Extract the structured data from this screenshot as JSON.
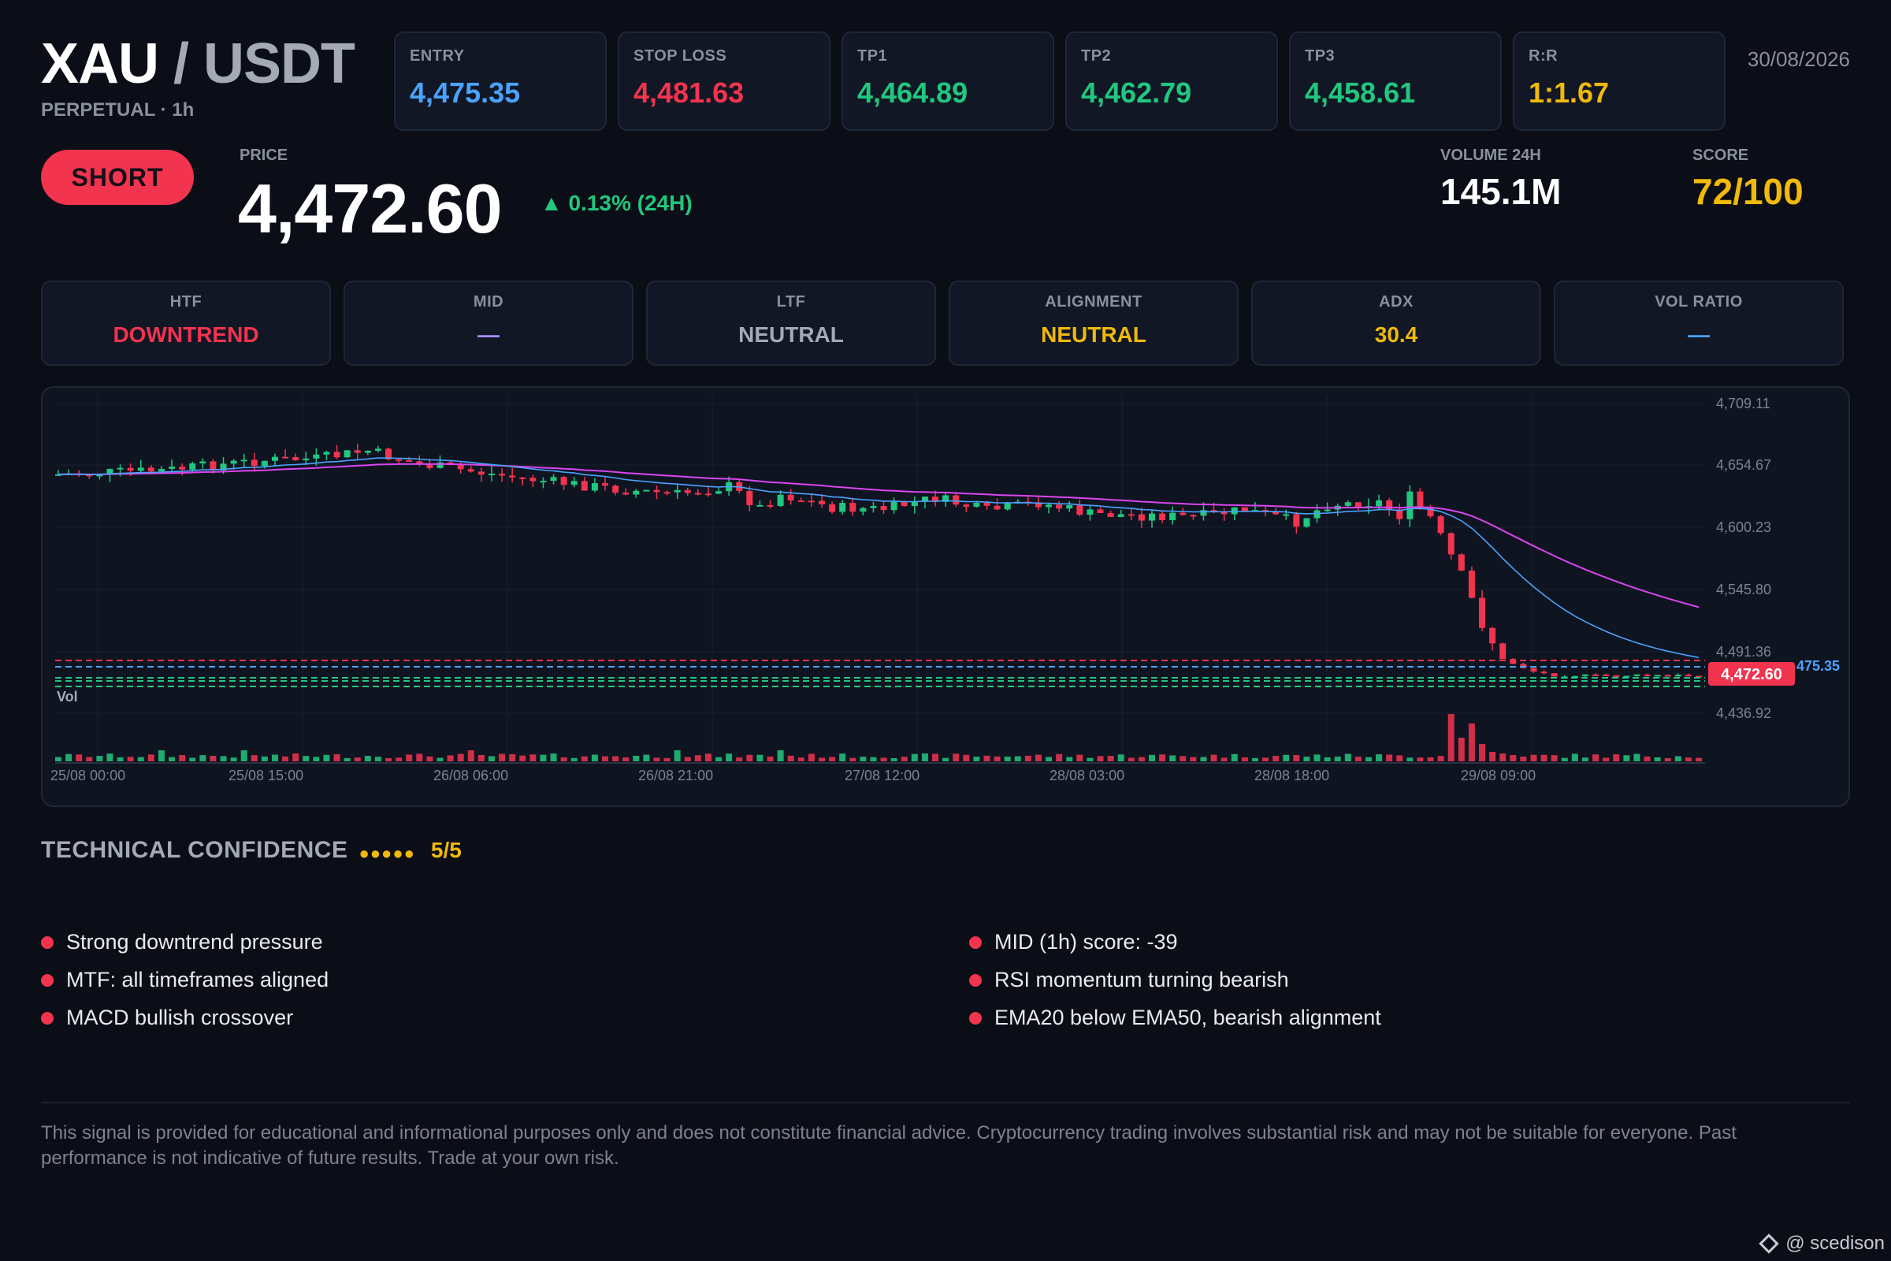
{
  "header": {
    "base": "XAU",
    "separator": " / ",
    "quote": "USDT",
    "subtitle": "PERPETUAL · 1h",
    "date": "30/08/2026"
  },
  "levels": [
    {
      "label": "ENTRY",
      "value": "4,475.35",
      "color": "#4aa3ff"
    },
    {
      "label": "STOP LOSS",
      "value": "4,481.63",
      "color": "#f2344f"
    },
    {
      "label": "TP1",
      "value": "4,464.89",
      "color": "#22c77f"
    },
    {
      "label": "TP2",
      "value": "4,462.79",
      "color": "#22c77f"
    },
    {
      "label": "TP3",
      "value": "4,458.61",
      "color": "#22c77f"
    },
    {
      "label": "R:R",
      "value": "1:1.67",
      "color": "#f0b90b"
    }
  ],
  "signal": {
    "direction": "SHORT",
    "price_label": "PRICE",
    "price": "4,472.60",
    "change": "▲ 0.13% (24H)"
  },
  "stats": {
    "volume_label": "VOLUME 24H",
    "volume": "145.1M",
    "score_label": "SCORE",
    "score": "72/100"
  },
  "indicators": [
    {
      "label": "HTF",
      "value": "DOWNTREND",
      "color": "#f2344f"
    },
    {
      "label": "MID",
      "value": "—",
      "color": "#a78bfa"
    },
    {
      "label": "LTF",
      "value": "NEUTRAL",
      "color": "#a4a9b6"
    },
    {
      "label": "ALIGNMENT",
      "value": "NEUTRAL",
      "color": "#f0b90b"
    },
    {
      "label": "ADX",
      "value": "30.4",
      "color": "#f0b90b"
    },
    {
      "label": "VOL RATIO",
      "value": "—",
      "color": "#4aa3ff"
    }
  ],
  "chart": {
    "y_ticks": [
      "4,709.11",
      "4,654.67",
      "4,600.23",
      "4,545.80",
      "4,491.36",
      "4,436.92"
    ],
    "x_ticks": [
      "25/08 00:00",
      "25/08 15:00",
      "26/08 06:00",
      "26/08 21:00",
      "27/08 12:00",
      "28/08 03:00",
      "28/08 18:00",
      "29/08 09:00"
    ],
    "vol_label": "Vol",
    "price_tag": "4,472.60",
    "entry_tag": "475.35"
  },
  "confidence": {
    "title": "TECHNICAL CONFIDENCE",
    "dots": "●●●●●",
    "score": "5/5"
  },
  "reasons_left": [
    "Strong downtrend pressure",
    "MTF: all timeframes aligned",
    "MACD bullish crossover"
  ],
  "reasons_right": [
    "MID (1h) score: -39",
    "RSI momentum turning bearish",
    "EMA20 below EMA50, bearish alignment"
  ],
  "disclaimer": "This signal is provided for educational and informational purposes only and does not constitute financial advice. Cryptocurrency trading involves substantial risk and may not be suitable for everyone. Past performance is not indicative of future results. Trade at your own risk.",
  "credit": "@ scedison"
}
